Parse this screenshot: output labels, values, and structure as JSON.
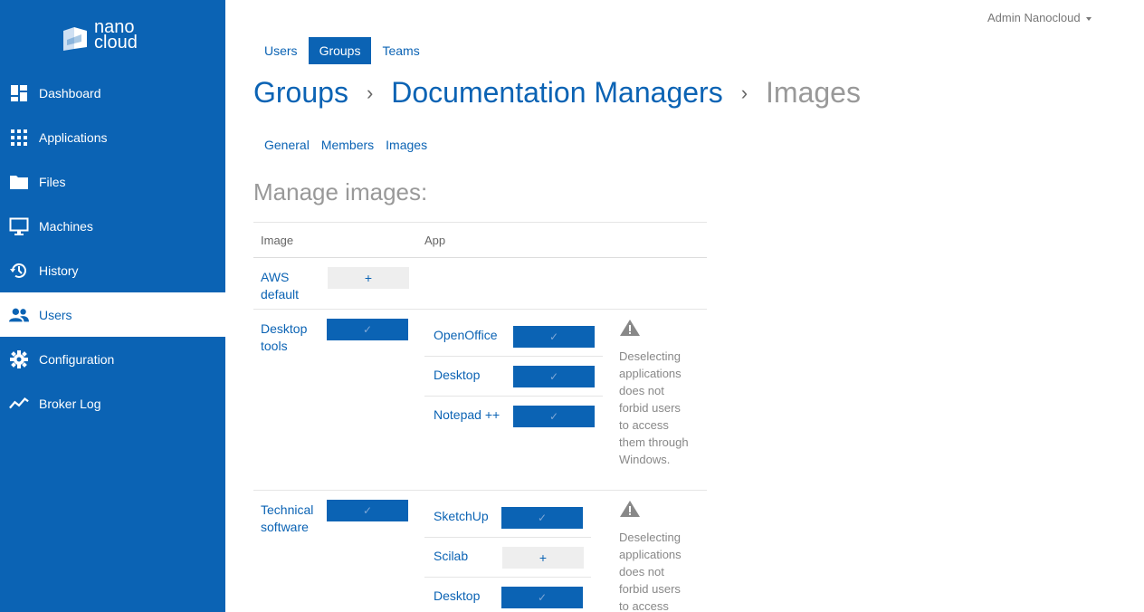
{
  "brand": {
    "line1": "nano",
    "line2": "cloud"
  },
  "sidebar": {
    "items": [
      {
        "label": "Dashboard",
        "icon": "dashboard-icon"
      },
      {
        "label": "Applications",
        "icon": "grid-icon"
      },
      {
        "label": "Files",
        "icon": "folder-icon"
      },
      {
        "label": "Machines",
        "icon": "monitor-icon"
      },
      {
        "label": "History",
        "icon": "history-icon"
      },
      {
        "label": "Users",
        "icon": "users-icon",
        "active": true
      },
      {
        "label": "Configuration",
        "icon": "gear-icon"
      },
      {
        "label": "Broker Log",
        "icon": "chart-line-icon"
      }
    ]
  },
  "user_menu": {
    "label": "Admin Nanocloud"
  },
  "top_tabs": [
    {
      "label": "Users"
    },
    {
      "label": "Groups",
      "active": true
    },
    {
      "label": "Teams"
    }
  ],
  "breadcrumb": {
    "root": "Groups",
    "group": "Documentation Managers",
    "current": "Images"
  },
  "sub_tabs": [
    "General",
    "Members",
    "Images"
  ],
  "manage_title": "Manage images:",
  "table": {
    "headers": {
      "image": "Image",
      "app": "App"
    },
    "rows": [
      {
        "image": "AWS default",
        "enabled": false,
        "apps": []
      },
      {
        "image": "Desktop tools",
        "enabled": true,
        "apps": [
          {
            "name": "OpenOffice",
            "enabled": true
          },
          {
            "name": "Desktop",
            "enabled": true
          },
          {
            "name": "Notepad ++",
            "enabled": true
          }
        ],
        "note": "Deselecting applications does not forbid users to access them through Windows."
      },
      {
        "image": "Technical software",
        "enabled": true,
        "apps": [
          {
            "name": "SketchUp",
            "enabled": true
          },
          {
            "name": "Scilab",
            "enabled": false
          },
          {
            "name": "Desktop",
            "enabled": true
          }
        ],
        "note": "Deselecting applications does not forbid users to access"
      }
    ],
    "check_glyph": "✓",
    "plus_glyph": "+"
  },
  "colors": {
    "primary": "#0b63b4",
    "muted": "#999999"
  }
}
